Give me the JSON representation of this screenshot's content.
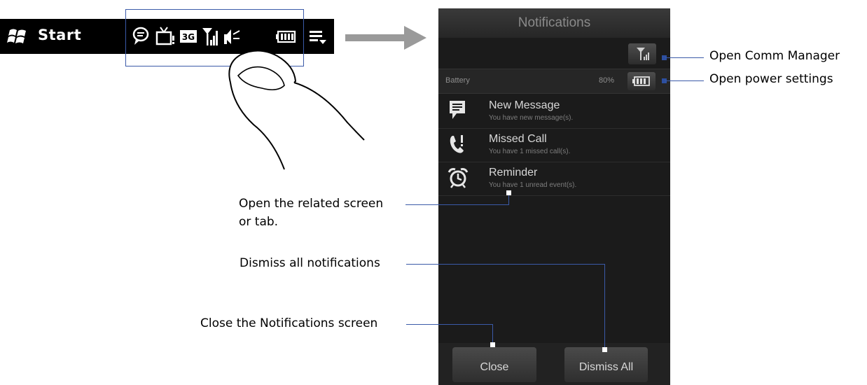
{
  "status_bar": {
    "start_label": "Start",
    "icons": [
      "windows-flag-icon",
      "message-bubble-icon",
      "tv-icon",
      "3g-icon",
      "signal-icon",
      "speaker-icon",
      "battery-icon",
      "menu-icon"
    ],
    "badge_3g": "3G"
  },
  "phone": {
    "title": "Notifications",
    "battery": {
      "label": "Battery",
      "percent": "80%"
    },
    "notifications": [
      {
        "icon": "message-icon",
        "title": "New Message",
        "subtitle": "You have new message(s)."
      },
      {
        "icon": "missed-call-icon",
        "title": "Missed Call",
        "subtitle": "You have 1 missed call(s)."
      },
      {
        "icon": "alarm-clock-icon",
        "title": "Reminder",
        "subtitle": "You have 1 unread event(s)."
      }
    ],
    "buttons": {
      "close": "Close",
      "dismiss_all": "Dismiss All"
    }
  },
  "callouts": {
    "comm_manager": "Open Comm Manager",
    "power_settings": "Open power settings",
    "related_line1": "Open the related screen",
    "related_line2": "or tab.",
    "dismiss_all": "Dismiss all notifications",
    "close_screen": "Close the Notifications screen"
  },
  "colors": {
    "accent_line": "#3b5aa8",
    "phone_bg": "#1b1b1b",
    "status_bar": "#000000"
  }
}
